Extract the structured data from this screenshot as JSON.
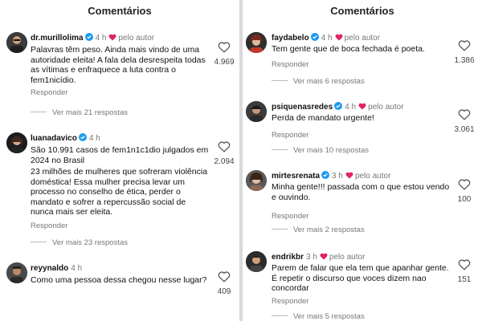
{
  "left": {
    "title": "Comentários",
    "comments": [
      {
        "username": "dr.murillolima",
        "time": "4 h",
        "author_label": "pelo autor",
        "text": "Palavras têm peso. Ainda mais vindo de uma autoridade eleita! A fala dela desrespeita todas as vítimas e enfraquece a luta contra o fem1nicídio.",
        "reply": "Responder",
        "more_replies": "Ver mais 21 respostas",
        "likes": "4.969"
      },
      {
        "username": "luanadavico",
        "time": "4 h",
        "text1": "São 10.991 casos de fem1n1c1dio julgados em 2024 no Brasil",
        "text2": "23 milhões de mulheres que sofreram violência doméstica! Essa mulher precisa levar um processo no conselho de ética, perder o mandato e sofrer a repercussão social de nunca mais ser eleita.",
        "reply": "Responder",
        "more_replies": "Ver mais 23 respostas",
        "likes": "2.094"
      },
      {
        "username": "reyynaldo",
        "time": "4 h",
        "text": "Como uma pessoa dessa chegou nesse lugar?",
        "likes": "409"
      }
    ]
  },
  "right": {
    "title": "Comentários",
    "comments": [
      {
        "username": "faydabelo",
        "time": "4 h",
        "author_label": "pelo autor",
        "text": "Tem gente que de boca fechada é poeta.",
        "reply": "Responder",
        "more_replies": "Ver mais 6 respostas",
        "likes": "1.386"
      },
      {
        "username": "psiquenasredes",
        "time": "4 h",
        "author_label": "pelo autor",
        "text": "Perda de mandato urgente!",
        "reply": "Responder",
        "more_replies": "Ver mais 10 respostas",
        "likes": "3.061"
      },
      {
        "username": "mirtesrenata",
        "time": "3 h",
        "author_label": "pelo autor",
        "text": "Minha gente!!! passada com o que estou vendo e ouvindo.",
        "reply": "Responder",
        "more_replies": "Ver mais 2 respostas",
        "likes": "100"
      },
      {
        "username": "endrikbr",
        "time": "3 h",
        "author_label": "pelo autor",
        "text": "Parem de falar que ela tem que apanhar gente. É repetir o discurso que voces dizem nao concordar",
        "reply": "Responder",
        "more_replies": "Ver mais 5 respostas",
        "likes": "151"
      }
    ]
  },
  "colors": {
    "verified": "#1d9bf0",
    "heart": "#e0245e",
    "muted": "#777777",
    "divider": "#dadada"
  },
  "icons": {
    "verified": "verified-badge-icon",
    "author_heart": "heart-filled-icon",
    "like": "heart-outline-icon"
  }
}
